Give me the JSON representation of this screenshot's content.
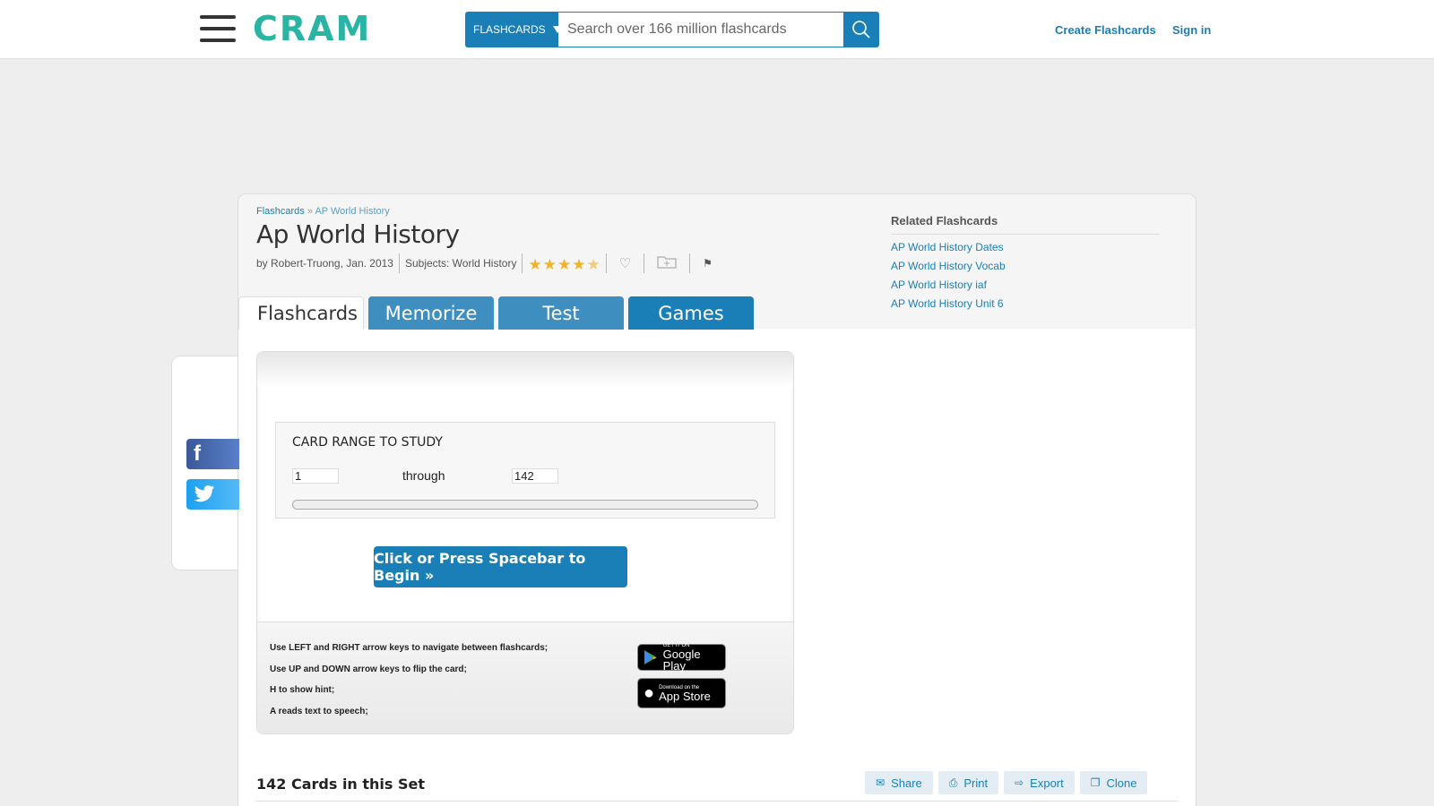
{
  "header": {
    "logo": "CRAM",
    "search_type": "FLASHCARDS",
    "search_placeholder": "Search over 166 million flashcards",
    "create_link": "Create Flashcards",
    "signin_link": "Sign in"
  },
  "breadcrumb": {
    "root": "Flashcards",
    "sep": "»",
    "current": "AP World History"
  },
  "title": "Ap World History",
  "meta": {
    "author": "by Robert-Truong, Jan. 2013",
    "subjects": "Subjects: World History",
    "rating": 4.5
  },
  "related": {
    "heading": "Related Flashcards",
    "items": [
      "AP World History Dates",
      "AP World History Vocab",
      "AP World History iaf",
      "AP World History Unit 6"
    ]
  },
  "tabs": [
    {
      "label": "Flashcards",
      "active": true
    },
    {
      "label": "Memorize"
    },
    {
      "label": "Test"
    },
    {
      "label": "Games"
    }
  ],
  "study": {
    "range_title": "CARD RANGE TO STUDY",
    "from": "1",
    "through": "through",
    "to": "142",
    "begin": "Click or Press Spacebar to Begin »",
    "hints": [
      "Use LEFT and RIGHT arrow keys to navigate between flashcards;",
      "Use UP and DOWN arrow keys to flip the card;",
      "H to show hint;",
      "A reads text to speech;"
    ],
    "google_small": "GET IT ON",
    "google_big": "Google Play",
    "apple_small": "Download on the",
    "apple_big": "App Store"
  },
  "cards_count": "142 Cards in this Set",
  "actions": {
    "share": "Share",
    "print": "Print",
    "export": "Export",
    "clone": "Clone"
  },
  "colors": {
    "brand_teal": "#2ab4a4",
    "primary_blue": "#1a7fb7",
    "star_gold": "#f0b323"
  }
}
